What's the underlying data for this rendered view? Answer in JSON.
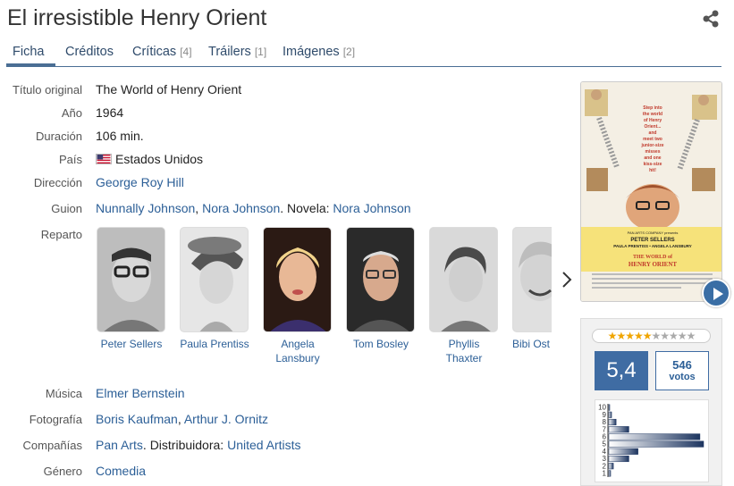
{
  "title": "El irresistible Henry Orient",
  "tabs": [
    {
      "label": "Ficha",
      "count": ""
    },
    {
      "label": "Créditos",
      "count": ""
    },
    {
      "label": "Críticas",
      "count": "[4]"
    },
    {
      "label": "Tráilers",
      "count": "[1]"
    },
    {
      "label": "Imágenes",
      "count": "[2]"
    }
  ],
  "info": {
    "titulo_original": {
      "label": "Título original",
      "value": "The World of Henry Orient"
    },
    "anio": {
      "label": "Año",
      "value": "1964"
    },
    "duracion": {
      "label": "Duración",
      "value": "106 min."
    },
    "pais": {
      "label": "País",
      "value": "Estados Unidos"
    },
    "direccion": {
      "label": "Dirección",
      "value": "George Roy Hill"
    },
    "guion": {
      "label": "Guion",
      "writer1": "Nunnally Johnson",
      "sep": ",",
      "writer2": "Nora Johnson",
      "novel_prefix": ". Novela:",
      "novel": "Nora Johnson"
    },
    "reparto_label": "Reparto",
    "musica": {
      "label": "Música",
      "value": "Elmer Bernstein"
    },
    "fotografia": {
      "label": "Fotografía",
      "value1": "Boris Kaufman",
      "sep": ",",
      "value2": "Arthur J. Ornitz"
    },
    "companias": {
      "label": "Compañías",
      "value1": "Pan Arts",
      "mid": ". Distribuidora:",
      "value2": "United Artists"
    },
    "genero": {
      "label": "Género",
      "value": "Comedia"
    }
  },
  "cast": [
    {
      "name": "Peter Sellers"
    },
    {
      "name": "Paula Prentiss"
    },
    {
      "name": "Angela Lansbury"
    },
    {
      "name": "Tom Bosley"
    },
    {
      "name": "Phyllis Thaxter"
    },
    {
      "name": "Bibi Ost"
    }
  ],
  "poster": {
    "tagline": "Step into the world of Henry Orient... and meet two junior-size misses and one kiss-size hit!",
    "studio": "PAN ARTS COMPANY presents",
    "stars": "PETER SELLERS",
    "costars": "PAULA PRENTISS • ANGELA LANSBURY",
    "film_title": "THE WORLD of HENRY ORIENT"
  },
  "rating": {
    "score": "5,4",
    "votes": "546",
    "votes_label": "votos",
    "stars_filled": 5,
    "stars_total": 10,
    "histogram": {
      "labels": [
        "10",
        "9",
        "8",
        "7",
        "6",
        "5",
        "4",
        "3",
        "2",
        "1"
      ],
      "values": [
        1,
        3,
        8,
        22,
        100,
        104,
        32,
        22,
        5,
        2
      ]
    }
  },
  "colors": {
    "link": "#2c5f97",
    "accent": "#3f6ca3",
    "bar_dark": "#1d3560",
    "bar_light": "#ffffff"
  }
}
